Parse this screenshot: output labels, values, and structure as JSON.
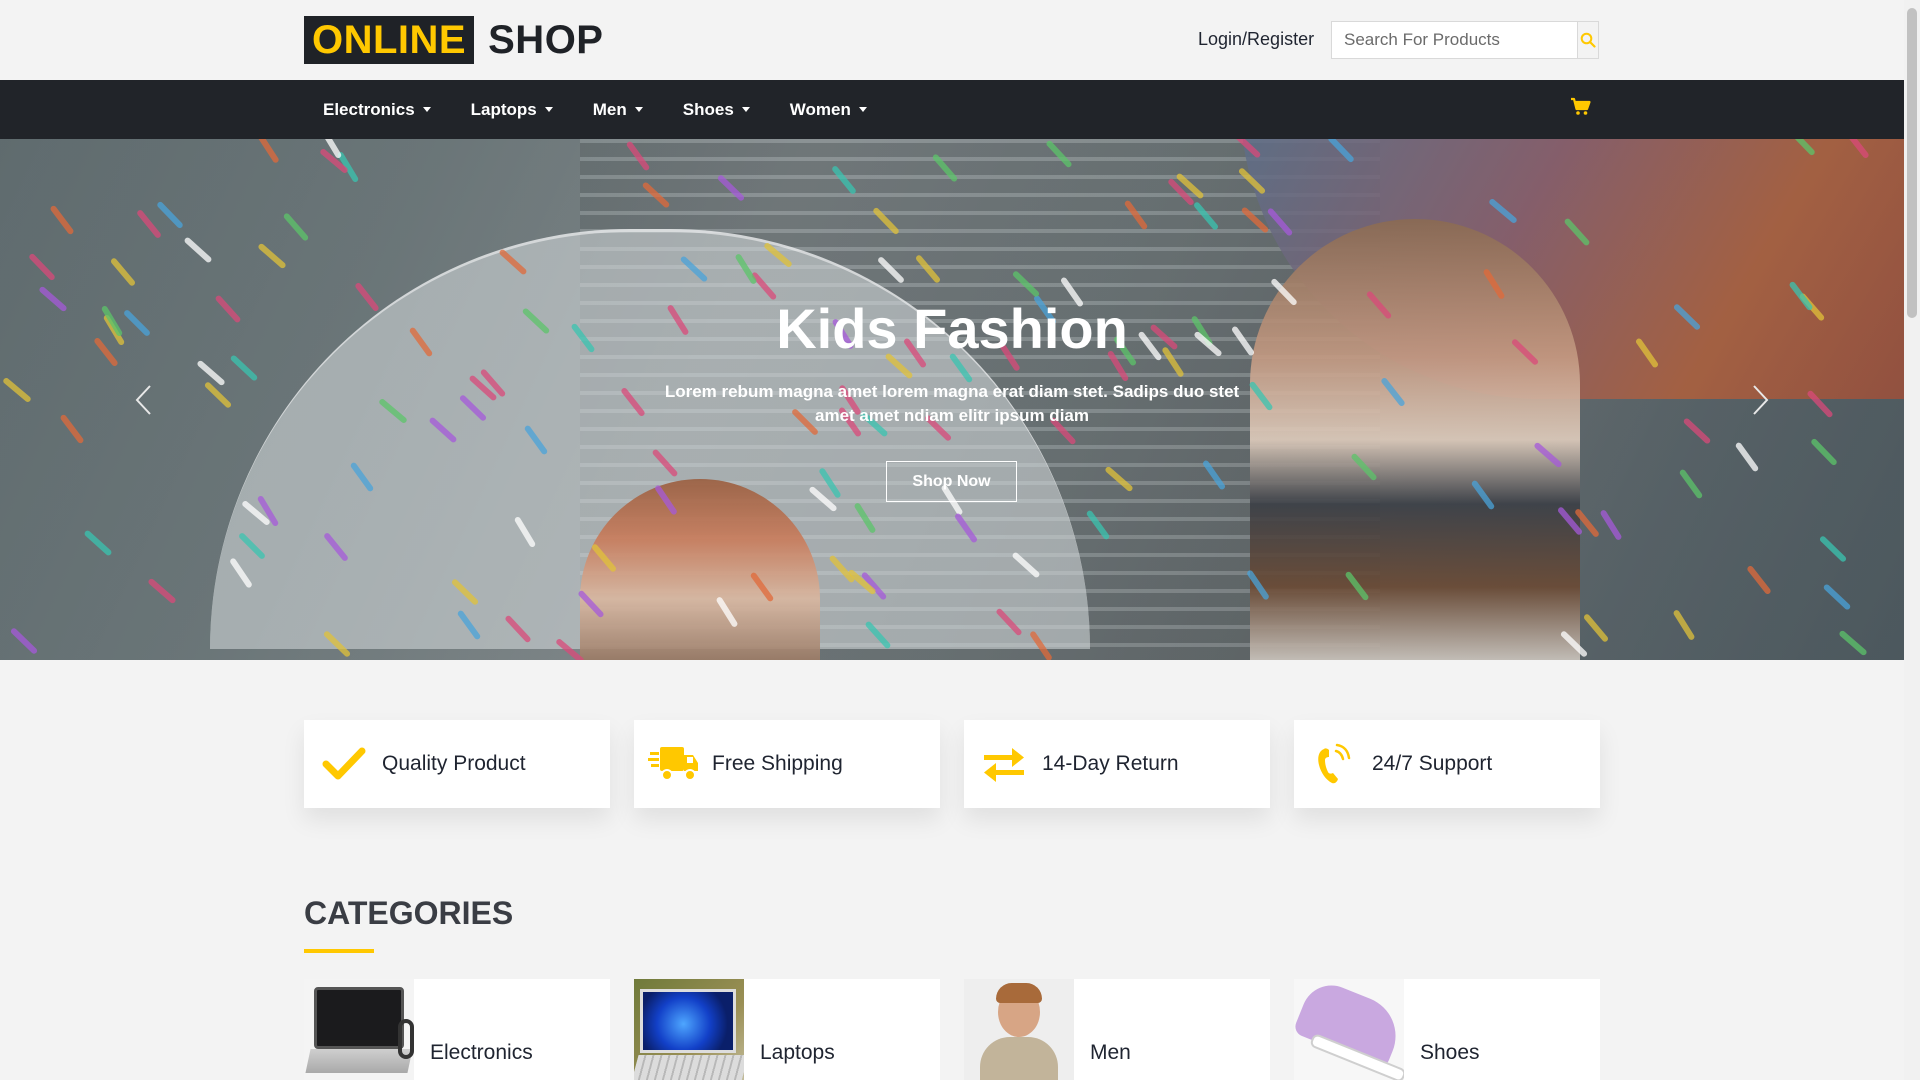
{
  "header": {
    "logo_highlight": "ONLINE",
    "logo_text": "SHOP",
    "login_label": "Login/Register",
    "search_placeholder": "Search For Products",
    "accent_color": "#ffc800"
  },
  "nav": {
    "items": [
      {
        "label": "Electronics"
      },
      {
        "label": "Laptops"
      },
      {
        "label": "Men"
      },
      {
        "label": "Shoes"
      },
      {
        "label": "Women"
      }
    ],
    "cart_icon": "cart-icon"
  },
  "hero": {
    "title": "Kids Fashion",
    "subtitle": "Lorem rebum magna amet lorem magna erat diam stet. Sadips duo stet amet amet ndiam elitr ipsum diam",
    "button_label": "Shop Now"
  },
  "features": [
    {
      "label": "Quality Product",
      "icon": "check-icon"
    },
    {
      "label": "Free Shipping",
      "icon": "truck-icon"
    },
    {
      "label": "14-Day Return",
      "icon": "exchange-icon"
    },
    {
      "label": "24/7 Support",
      "icon": "phone-icon"
    }
  ],
  "categories": {
    "title": "CATEGORIES",
    "items": [
      {
        "label": "Electronics"
      },
      {
        "label": "Laptops"
      },
      {
        "label": "Men"
      },
      {
        "label": "Shoes"
      }
    ]
  }
}
